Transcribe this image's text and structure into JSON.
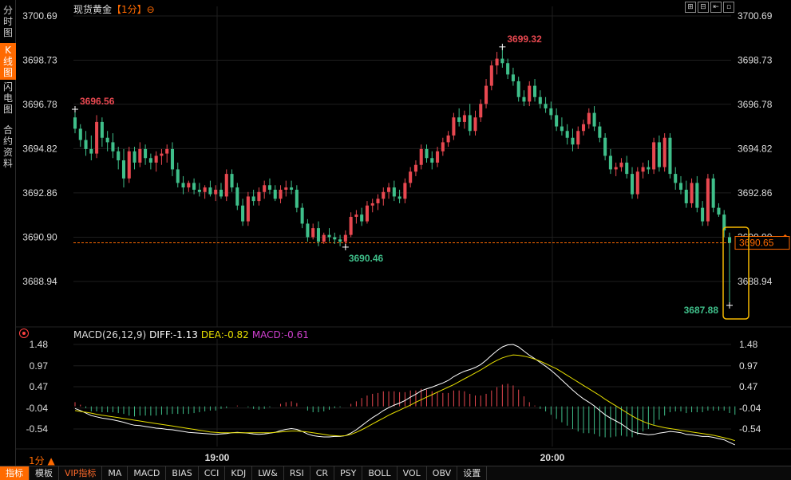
{
  "sidebar": {
    "tabs": [
      {
        "label": "分时图",
        "active": false
      },
      {
        "label": "K线图",
        "active": true
      },
      {
        "label": "闪电图",
        "active": false
      },
      {
        "label": "合约资料",
        "active": false
      }
    ]
  },
  "header": {
    "title": "现货黄金",
    "period": "【1分】",
    "period_icon": "⊖",
    "toolbar_icons": [
      "zoom-in-icon",
      "zoom-out-icon",
      "fit-icon",
      "settings-icon"
    ]
  },
  "price_axis": {
    "labels": [
      "3700.69",
      "3698.73",
      "3696.78",
      "3694.82",
      "3692.86",
      "3690.90",
      "3688.94"
    ],
    "current_price": "3690.65"
  },
  "annotations": {
    "high_left": "3696.56",
    "high": "3699.32",
    "low_mid": "3690.46",
    "low_last": "3687.88"
  },
  "macd": {
    "title": "MACD(26,12,9)",
    "diff": "DIFF:-1.13",
    "dea": "DEA:-0.82",
    "macd": "MACD:-0.61",
    "axis_labels": [
      "1.48",
      "0.97",
      "0.47",
      "-0.04",
      "-0.54"
    ]
  },
  "time_axis": [
    "19:00",
    "20:00"
  ],
  "period_indicator": "1分 ▲",
  "indicator_tabs": [
    "指标",
    "模板",
    "VIP指标",
    "MA",
    "MACD",
    "BIAS",
    "CCI",
    "KDJ",
    "LW&",
    "RSI",
    "CR",
    "PSY",
    "BOLL",
    "VOL",
    "OBV",
    "设置"
  ],
  "colors": {
    "up": "#e84850",
    "down": "#3fbf8a",
    "diff": "#ffffff",
    "dea": "#e8e000",
    "accent": "#ff6a00",
    "highlight": "#f5b800"
  },
  "chart_data": [
    {
      "type": "candlestick",
      "title": "现货黄金",
      "ylim": [
        3687.5,
        3700.69
      ],
      "x_ticks": [
        "19:00",
        "20:00"
      ],
      "candles": [
        [
          3696.2,
          3696.56,
          3695.5,
          3695.7
        ],
        [
          3695.7,
          3695.9,
          3694.9,
          3695.2
        ],
        [
          3695.2,
          3695.6,
          3694.5,
          3694.8
        ],
        [
          3694.8,
          3695.4,
          3694.3,
          3694.6
        ],
        [
          3694.6,
          3696.3,
          3694.4,
          3696.0
        ],
        [
          3696.0,
          3696.2,
          3694.9,
          3695.3
        ],
        [
          3695.3,
          3695.6,
          3694.7,
          3695.1
        ],
        [
          3695.1,
          3695.5,
          3694.4,
          3694.7
        ],
        [
          3694.7,
          3694.9,
          3693.9,
          3694.3
        ],
        [
          3694.3,
          3694.8,
          3693.1,
          3693.5
        ],
        [
          3693.5,
          3694.9,
          3693.3,
          3694.7
        ],
        [
          3694.7,
          3694.9,
          3693.9,
          3694.2
        ],
        [
          3694.2,
          3695.1,
          3694.0,
          3694.8
        ],
        [
          3694.8,
          3695.0,
          3694.1,
          3694.4
        ],
        [
          3694.4,
          3694.6,
          3693.9,
          3694.2
        ],
        [
          3694.2,
          3694.7,
          3693.8,
          3694.5
        ],
        [
          3694.5,
          3694.8,
          3694.1,
          3694.6
        ],
        [
          3694.6,
          3695.0,
          3694.2,
          3694.8
        ],
        [
          3694.8,
          3695.1,
          3693.6,
          3693.9
        ],
        [
          3693.9,
          3694.2,
          3693.1,
          3693.3
        ],
        [
          3693.3,
          3693.6,
          3692.8,
          3693.1
        ],
        [
          3693.1,
          3693.4,
          3692.9,
          3693.3
        ],
        [
          3693.3,
          3693.5,
          3692.8,
          3693.0
        ],
        [
          3693.0,
          3693.3,
          3692.7,
          3692.9
        ],
        [
          3692.9,
          3693.2,
          3692.6,
          3693.1
        ],
        [
          3693.1,
          3693.4,
          3692.7,
          3692.8
        ],
        [
          3692.8,
          3693.2,
          3692.5,
          3693.0
        ],
        [
          3693.0,
          3693.3,
          3692.6,
          3692.7
        ],
        [
          3692.7,
          3693.9,
          3692.5,
          3693.7
        ],
        [
          3693.7,
          3693.9,
          3692.9,
          3693.1
        ],
        [
          3693.1,
          3693.3,
          3692.1,
          3692.3
        ],
        [
          3692.3,
          3692.6,
          3691.4,
          3691.6
        ],
        [
          3691.6,
          3692.9,
          3691.4,
          3692.7
        ],
        [
          3692.7,
          3693.0,
          3692.3,
          3692.5
        ],
        [
          3692.5,
          3693.1,
          3692.3,
          3692.9
        ],
        [
          3692.9,
          3693.4,
          3692.6,
          3693.2
        ],
        [
          3693.2,
          3693.5,
          3692.8,
          3693.0
        ],
        [
          3693.0,
          3693.2,
          3692.5,
          3692.6
        ],
        [
          3692.6,
          3693.2,
          3692.4,
          3693.0
        ],
        [
          3693.0,
          3693.4,
          3692.7,
          3693.1
        ],
        [
          3693.1,
          3693.4,
          3692.8,
          3693.0
        ],
        [
          3693.0,
          3693.2,
          3692.0,
          3692.2
        ],
        [
          3692.2,
          3692.4,
          3691.3,
          3691.5
        ],
        [
          3691.5,
          3691.7,
          3690.7,
          3690.9
        ],
        [
          3690.9,
          3691.5,
          3690.8,
          3691.3
        ],
        [
          3691.3,
          3691.6,
          3690.5,
          3690.7
        ],
        [
          3690.7,
          3691.1,
          3690.6,
          3691.0
        ],
        [
          3691.0,
          3691.3,
          3690.7,
          3690.9
        ],
        [
          3690.9,
          3691.1,
          3690.6,
          3690.8
        ],
        [
          3690.8,
          3691.0,
          3690.5,
          3690.7
        ],
        [
          3690.7,
          3691.2,
          3690.46,
          3691.0
        ],
        [
          3691.0,
          3692.0,
          3690.9,
          3691.8
        ],
        [
          3691.8,
          3692.1,
          3691.5,
          3691.9
        ],
        [
          3691.9,
          3692.2,
          3691.4,
          3691.6
        ],
        [
          3691.6,
          3692.5,
          3691.5,
          3692.3
        ],
        [
          3692.3,
          3692.6,
          3692.0,
          3692.4
        ],
        [
          3692.4,
          3692.8,
          3692.1,
          3692.6
        ],
        [
          3692.6,
          3693.1,
          3692.3,
          3692.9
        ],
        [
          3692.9,
          3693.3,
          3692.6,
          3693.1
        ],
        [
          3693.1,
          3693.4,
          3692.5,
          3692.7
        ],
        [
          3692.7,
          3693.0,
          3692.4,
          3692.6
        ],
        [
          3692.6,
          3693.5,
          3692.4,
          3693.3
        ],
        [
          3693.3,
          3694.0,
          3693.1,
          3693.8
        ],
        [
          3693.8,
          3694.3,
          3693.6,
          3694.1
        ],
        [
          3694.1,
          3695.0,
          3693.9,
          3694.8
        ],
        [
          3694.8,
          3695.0,
          3694.2,
          3694.4
        ],
        [
          3694.4,
          3694.7,
          3693.9,
          3694.2
        ],
        [
          3694.2,
          3694.9,
          3694.0,
          3694.7
        ],
        [
          3694.7,
          3695.3,
          3694.5,
          3695.1
        ],
        [
          3695.1,
          3695.6,
          3694.9,
          3695.4
        ],
        [
          3695.4,
          3696.4,
          3695.2,
          3696.2
        ],
        [
          3696.2,
          3696.6,
          3695.8,
          3696.0
        ],
        [
          3696.0,
          3696.5,
          3695.7,
          3696.3
        ],
        [
          3696.3,
          3696.8,
          3695.4,
          3695.6
        ],
        [
          3695.6,
          3696.5,
          3695.4,
          3696.2
        ],
        [
          3696.2,
          3697.0,
          3696.0,
          3696.8
        ],
        [
          3696.8,
          3697.9,
          3696.6,
          3697.6
        ],
        [
          3697.6,
          3698.7,
          3697.4,
          3698.5
        ],
        [
          3698.5,
          3699.1,
          3698.1,
          3698.8
        ],
        [
          3698.8,
          3699.32,
          3698.4,
          3698.6
        ],
        [
          3698.6,
          3698.8,
          3697.9,
          3698.1
        ],
        [
          3698.1,
          3698.4,
          3697.6,
          3697.8
        ],
        [
          3697.8,
          3698.0,
          3696.9,
          3697.1
        ],
        [
          3697.1,
          3697.4,
          3696.7,
          3696.9
        ],
        [
          3696.9,
          3697.8,
          3696.7,
          3697.6
        ],
        [
          3697.6,
          3697.9,
          3696.9,
          3697.1
        ],
        [
          3697.1,
          3697.4,
          3696.6,
          3696.8
        ],
        [
          3696.8,
          3697.1,
          3696.4,
          3696.6
        ],
        [
          3696.6,
          3696.9,
          3696.1,
          3696.3
        ],
        [
          3696.3,
          3696.6,
          3695.6,
          3695.8
        ],
        [
          3695.8,
          3696.2,
          3695.4,
          3695.6
        ],
        [
          3695.6,
          3695.9,
          3695.0,
          3695.3
        ],
        [
          3695.3,
          3695.7,
          3694.7,
          3695.0
        ],
        [
          3695.0,
          3695.8,
          3694.8,
          3695.6
        ],
        [
          3695.6,
          3696.1,
          3695.4,
          3695.9
        ],
        [
          3695.9,
          3696.6,
          3695.7,
          3696.4
        ],
        [
          3696.4,
          3696.7,
          3695.6,
          3695.8
        ],
        [
          3695.8,
          3696.0,
          3695.1,
          3695.3
        ],
        [
          3695.3,
          3695.5,
          3694.3,
          3694.5
        ],
        [
          3694.5,
          3694.8,
          3693.7,
          3693.9
        ],
        [
          3693.9,
          3694.2,
          3693.6,
          3694.0
        ],
        [
          3694.0,
          3694.4,
          3693.8,
          3694.2
        ],
        [
          3694.2,
          3694.5,
          3693.5,
          3693.7
        ],
        [
          3693.7,
          3694.0,
          3692.6,
          3692.8
        ],
        [
          3692.8,
          3694.0,
          3692.6,
          3693.8
        ],
        [
          3693.8,
          3694.2,
          3693.5,
          3694.0
        ],
        [
          3694.0,
          3694.3,
          3693.7,
          3693.9
        ],
        [
          3693.9,
          3695.3,
          3693.7,
          3695.1
        ],
        [
          3695.1,
          3695.4,
          3693.8,
          3694.0
        ],
        [
          3694.0,
          3695.5,
          3693.8,
          3695.3
        ],
        [
          3695.3,
          3695.5,
          3693.5,
          3693.7
        ],
        [
          3693.7,
          3694.0,
          3693.0,
          3693.3
        ],
        [
          3693.3,
          3693.6,
          3692.8,
          3693.0
        ],
        [
          3693.0,
          3693.4,
          3692.2,
          3692.4
        ],
        [
          3692.4,
          3693.5,
          3692.2,
          3693.3
        ],
        [
          3693.3,
          3693.6,
          3692.0,
          3692.2
        ],
        [
          3692.2,
          3692.5,
          3691.4,
          3691.6
        ],
        [
          3691.6,
          3693.7,
          3691.4,
          3693.5
        ],
        [
          3693.5,
          3693.7,
          3692.0,
          3692.2
        ],
        [
          3692.2,
          3692.4,
          3691.8,
          3691.9
        ],
        [
          3691.9,
          3692.1,
          3690.9,
          3691.2
        ],
        [
          3690.9,
          3691.1,
          3687.88,
          3690.65
        ]
      ]
    },
    {
      "type": "macd",
      "title": "MACD(26,12,9)",
      "ylim": [
        -0.95,
        1.48
      ],
      "series": [
        {
          "name": "DIFF",
          "values": [
            -0.05,
            -0.1,
            -0.16,
            -0.22,
            -0.25,
            -0.28,
            -0.3,
            -0.32,
            -0.35,
            -0.38,
            -0.42,
            -0.45,
            -0.46,
            -0.48,
            -0.5,
            -0.52,
            -0.53,
            -0.55,
            -0.56,
            -0.58,
            -0.6,
            -0.62,
            -0.63,
            -0.64,
            -0.65,
            -0.66,
            -0.67,
            -0.66,
            -0.65,
            -0.63,
            -0.62,
            -0.63,
            -0.64,
            -0.66,
            -0.67,
            -0.66,
            -0.64,
            -0.62,
            -0.58,
            -0.55,
            -0.53,
            -0.55,
            -0.6,
            -0.66,
            -0.7,
            -0.72,
            -0.73,
            -0.73,
            -0.72,
            -0.72,
            -0.7,
            -0.64,
            -0.56,
            -0.46,
            -0.36,
            -0.27,
            -0.19,
            -0.1,
            -0.03,
            0.03,
            0.08,
            0.14,
            0.22,
            0.29,
            0.37,
            0.42,
            0.46,
            0.51,
            0.56,
            0.62,
            0.71,
            0.78,
            0.84,
            0.88,
            0.93,
            1.0,
            1.1,
            1.22,
            1.33,
            1.42,
            1.47,
            1.48,
            1.42,
            1.32,
            1.22,
            1.14,
            1.05,
            0.96,
            0.86,
            0.75,
            0.63,
            0.51,
            0.39,
            0.28,
            0.18,
            0.1,
            0.01,
            -0.1,
            -0.2,
            -0.28,
            -0.35,
            -0.42,
            -0.51,
            -0.6,
            -0.64,
            -0.66,
            -0.68,
            -0.67,
            -0.64,
            -0.62,
            -0.6,
            -0.61,
            -0.63,
            -0.67,
            -0.68,
            -0.7,
            -0.72,
            -0.72,
            -0.74,
            -0.77,
            -0.8,
            -0.86,
            -0.92
          ]
        },
        {
          "name": "DEA",
          "values": [
            -0.1,
            -0.12,
            -0.14,
            -0.16,
            -0.19,
            -0.21,
            -0.23,
            -0.25,
            -0.27,
            -0.29,
            -0.31,
            -0.33,
            -0.35,
            -0.37,
            -0.39,
            -0.41,
            -0.43,
            -0.45,
            -0.47,
            -0.49,
            -0.51,
            -0.53,
            -0.55,
            -0.57,
            -0.59,
            -0.61,
            -0.62,
            -0.63,
            -0.63,
            -0.63,
            -0.63,
            -0.63,
            -0.63,
            -0.63,
            -0.63,
            -0.63,
            -0.63,
            -0.62,
            -0.61,
            -0.6,
            -0.59,
            -0.59,
            -0.6,
            -0.61,
            -0.63,
            -0.65,
            -0.67,
            -0.69,
            -0.7,
            -0.71,
            -0.7,
            -0.67,
            -0.62,
            -0.56,
            -0.49,
            -0.42,
            -0.35,
            -0.28,
            -0.21,
            -0.15,
            -0.09,
            -0.03,
            0.03,
            0.1,
            0.16,
            0.22,
            0.28,
            0.34,
            0.4,
            0.46,
            0.52,
            0.59,
            0.66,
            0.73,
            0.8,
            0.87,
            0.95,
            1.03,
            1.1,
            1.16,
            1.2,
            1.23,
            1.22,
            1.2,
            1.17,
            1.13,
            1.08,
            1.02,
            0.96,
            0.9,
            0.82,
            0.74,
            0.66,
            0.58,
            0.5,
            0.42,
            0.34,
            0.26,
            0.17,
            0.09,
            0.01,
            -0.07,
            -0.15,
            -0.23,
            -0.3,
            -0.36,
            -0.41,
            -0.45,
            -0.48,
            -0.51,
            -0.53,
            -0.55,
            -0.57,
            -0.59,
            -0.61,
            -0.63,
            -0.65,
            -0.67,
            -0.69,
            -0.72,
            -0.75,
            -0.78,
            -0.82
          ]
        }
      ],
      "histogram": [
        0.05,
        0.02,
        -0.02,
        -0.06,
        -0.06,
        -0.07,
        -0.07,
        -0.07,
        -0.08,
        -0.09,
        -0.11,
        -0.12,
        -0.11,
        -0.11,
        -0.11,
        -0.11,
        -0.1,
        -0.1,
        -0.09,
        -0.09,
        -0.09,
        -0.09,
        -0.08,
        -0.07,
        -0.06,
        -0.05,
        -0.05,
        -0.03,
        -0.02,
        0.0,
        0.01,
        0.0,
        -0.01,
        -0.03,
        -0.04,
        -0.03,
        -0.01,
        0.0,
        0.03,
        0.05,
        0.06,
        0.04,
        0.0,
        -0.05,
        -0.07,
        -0.07,
        -0.06,
        -0.04,
        -0.02,
        -0.01,
        0.0,
        0.03,
        0.06,
        0.1,
        0.13,
        0.15,
        0.16,
        0.18,
        0.18,
        0.18,
        0.17,
        0.17,
        0.19,
        0.19,
        0.21,
        0.2,
        0.18,
        0.17,
        0.16,
        0.16,
        0.19,
        0.19,
        0.18,
        0.15,
        0.13,
        0.13,
        0.15,
        0.19,
        0.23,
        0.26,
        0.27,
        0.25,
        0.2,
        0.12,
        0.05,
        0.01,
        -0.03,
        -0.06,
        -0.1,
        -0.15,
        -0.19,
        -0.23,
        -0.27,
        -0.3,
        -0.32,
        -0.32,
        -0.33,
        -0.36,
        -0.37,
        -0.37,
        -0.36,
        -0.35,
        -0.36,
        -0.37,
        -0.34,
        -0.3,
        -0.27,
        -0.22,
        -0.16,
        -0.11,
        -0.07,
        -0.06,
        -0.06,
        -0.08,
        -0.07,
        -0.07,
        -0.07,
        -0.05,
        -0.05,
        -0.05,
        -0.05,
        -0.08,
        -0.1
      ]
    }
  ]
}
